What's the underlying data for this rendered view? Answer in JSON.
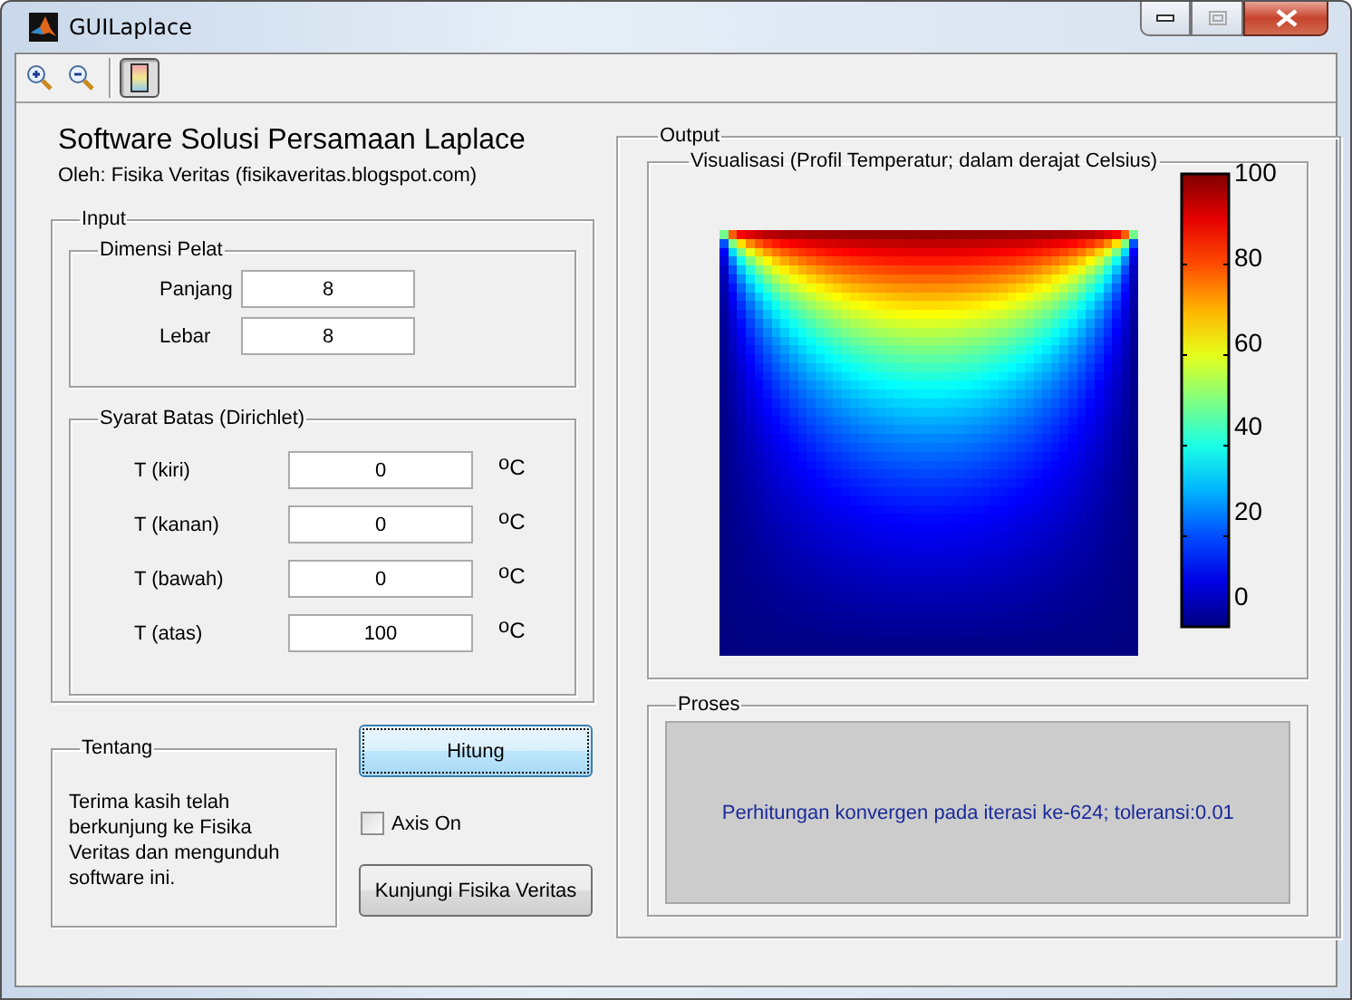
{
  "window": {
    "title": "GUILaplace"
  },
  "toolbar": [
    {
      "kind": "zoom_in",
      "selected": false
    },
    {
      "kind": "zoom_out",
      "selected": false
    },
    {
      "kind": "colorbar",
      "selected": true
    }
  ],
  "header": {
    "title": "Software Solusi Persamaan Laplace",
    "subtitle": "Oleh: Fisika Veritas (fisikaveritas.blogspot.com)"
  },
  "input": {
    "title": "Input",
    "dimensions": {
      "title": "Dimensi Pelat",
      "fields": [
        {
          "label": "Panjang",
          "value": "8"
        },
        {
          "label": "Lebar",
          "value": "8"
        }
      ]
    },
    "boundary": {
      "title": "Syarat Batas (Dirichlet)",
      "fields": [
        {
          "label": "T (kiri)",
          "value": "0",
          "unit": "$^{o}$C"
        },
        {
          "label": "T (kanan)",
          "value": "0",
          "unit": "$^{o}$C"
        },
        {
          "label": "T (bawah)",
          "value": "0",
          "unit": "$^{o}$C"
        },
        {
          "label": "T (atas)",
          "value": "100",
          "unit": "$^{o}$C"
        }
      ]
    }
  },
  "about": {
    "title": "Tentang",
    "text": "Terima kasih telah berkunjung ke Fisika Veritas dan mengunduh software ini."
  },
  "actions": {
    "compute_button": {
      "label": "Hitung",
      "focused": true
    },
    "axis_checkbox": {
      "label": "Axis On",
      "checked": false
    },
    "visit_button": {
      "label": "Kunjungi Fisika Veritas",
      "focused": false
    }
  },
  "output": {
    "title": "Output",
    "visualization": {
      "title": "Visualisasi (Profil Temperatur; dalam derajat Celsius)",
      "colorbar_ticks": [
        "100",
        "80",
        "60",
        "40",
        "20",
        "0"
      ]
    },
    "process": {
      "title": "Proses",
      "message": "Perhitungan konvergen pada iterasi ke-624; toleransi:0.01"
    }
  }
}
